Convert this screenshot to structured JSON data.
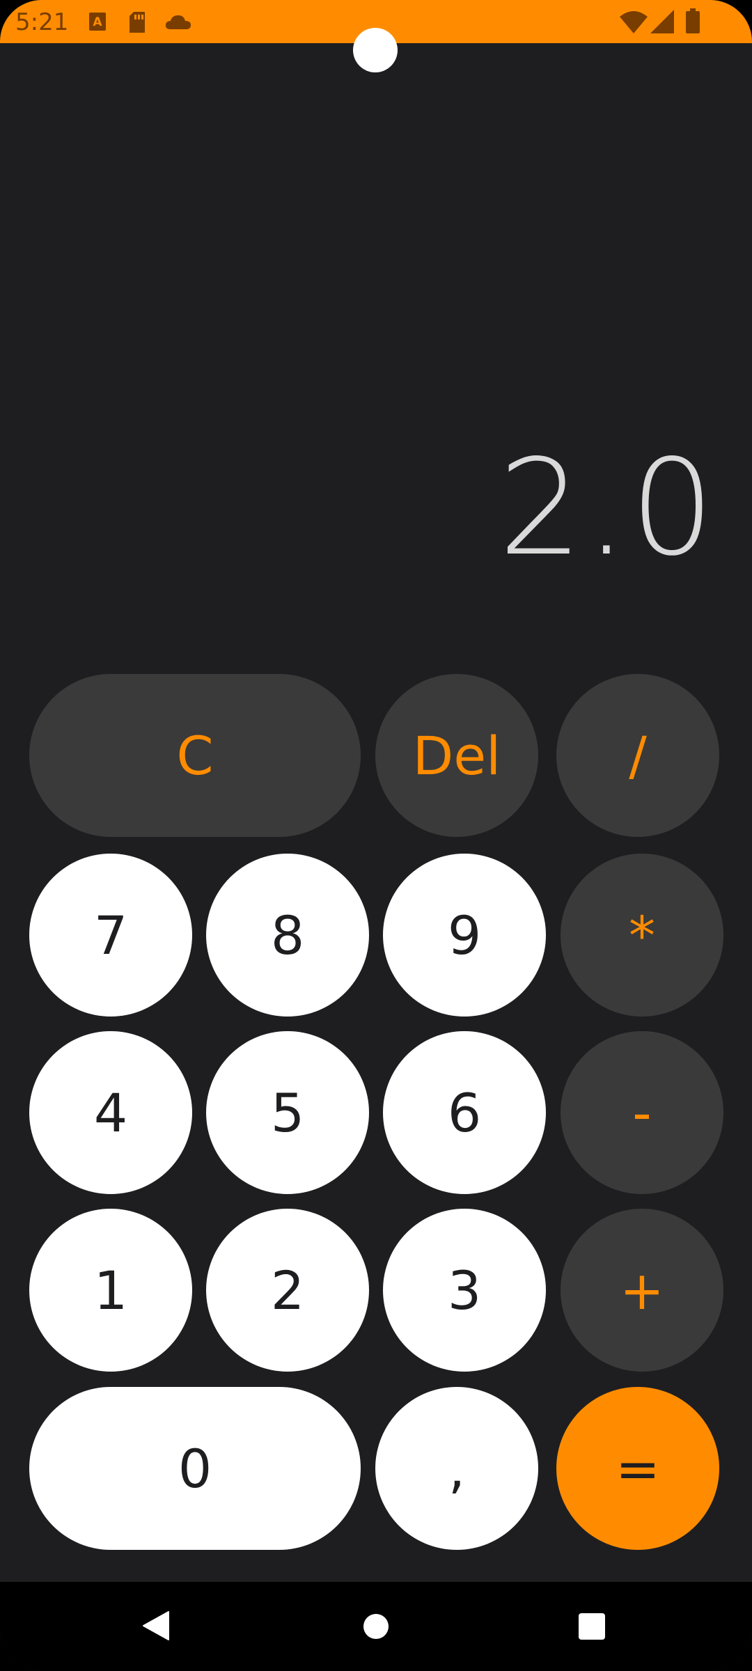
{
  "status_bar": {
    "time": "5:21",
    "background": "#ff8c00",
    "left_icons": [
      "text-a-icon",
      "sd-card-icon",
      "cloud-icon"
    ],
    "right_icons": [
      "wifi-icon",
      "signal-icon",
      "battery-icon"
    ]
  },
  "display": {
    "value": "2.0"
  },
  "keypad": {
    "clear": "C",
    "delete": "Del",
    "divide": "/",
    "seven": "7",
    "eight": "8",
    "nine": "9",
    "multiply": "*",
    "four": "4",
    "five": "5",
    "six": "6",
    "subtract": "-",
    "one": "1",
    "two": "2",
    "three": "3",
    "add": "+",
    "zero": "0",
    "comma": ",",
    "equals": "="
  },
  "colors": {
    "accent": "#ff8c00",
    "background": "#1e1e21",
    "operator_key": "#3a3a3a",
    "digit_key": "#ffffff",
    "display_text": "#d9d9d9"
  },
  "nav_bar": {
    "icons": [
      "back-icon",
      "home-icon",
      "recents-icon"
    ]
  }
}
